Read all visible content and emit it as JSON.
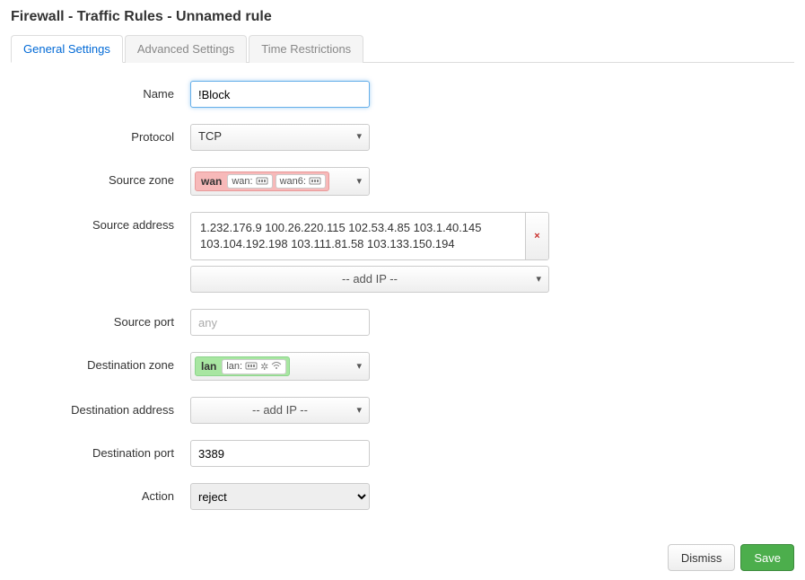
{
  "page_title": "Firewall - Traffic Rules - Unnamed rule",
  "tabs": {
    "general": "General Settings",
    "advanced": "Advanced Settings",
    "time": "Time Restrictions"
  },
  "labels": {
    "name": "Name",
    "protocol": "Protocol",
    "src_zone": "Source zone",
    "src_addr": "Source address",
    "src_port": "Source port",
    "dst_zone": "Destination zone",
    "dst_addr": "Destination address",
    "dst_port": "Destination port",
    "action": "Action"
  },
  "values": {
    "name": "!Block",
    "protocol": "TCP",
    "src_port_placeholder": "any",
    "dst_port": "3389",
    "action": "reject",
    "add_ip_label": "-- add IP --"
  },
  "src_zone": {
    "tag": "wan",
    "ifaces": [
      {
        "name": "wan:"
      },
      {
        "name": "wan6:"
      }
    ]
  },
  "dst_zone": {
    "tag": "lan",
    "ifaces": [
      {
        "name": "lan:"
      }
    ]
  },
  "src_addresses_display": "1.232.176.9 100.26.220.115 102.53.4.85 103.1.40.145 103.104.192.198 103.111.81.58 103.133.150.194",
  "buttons": {
    "dismiss": "Dismiss",
    "save": "Save",
    "remove": "×"
  }
}
